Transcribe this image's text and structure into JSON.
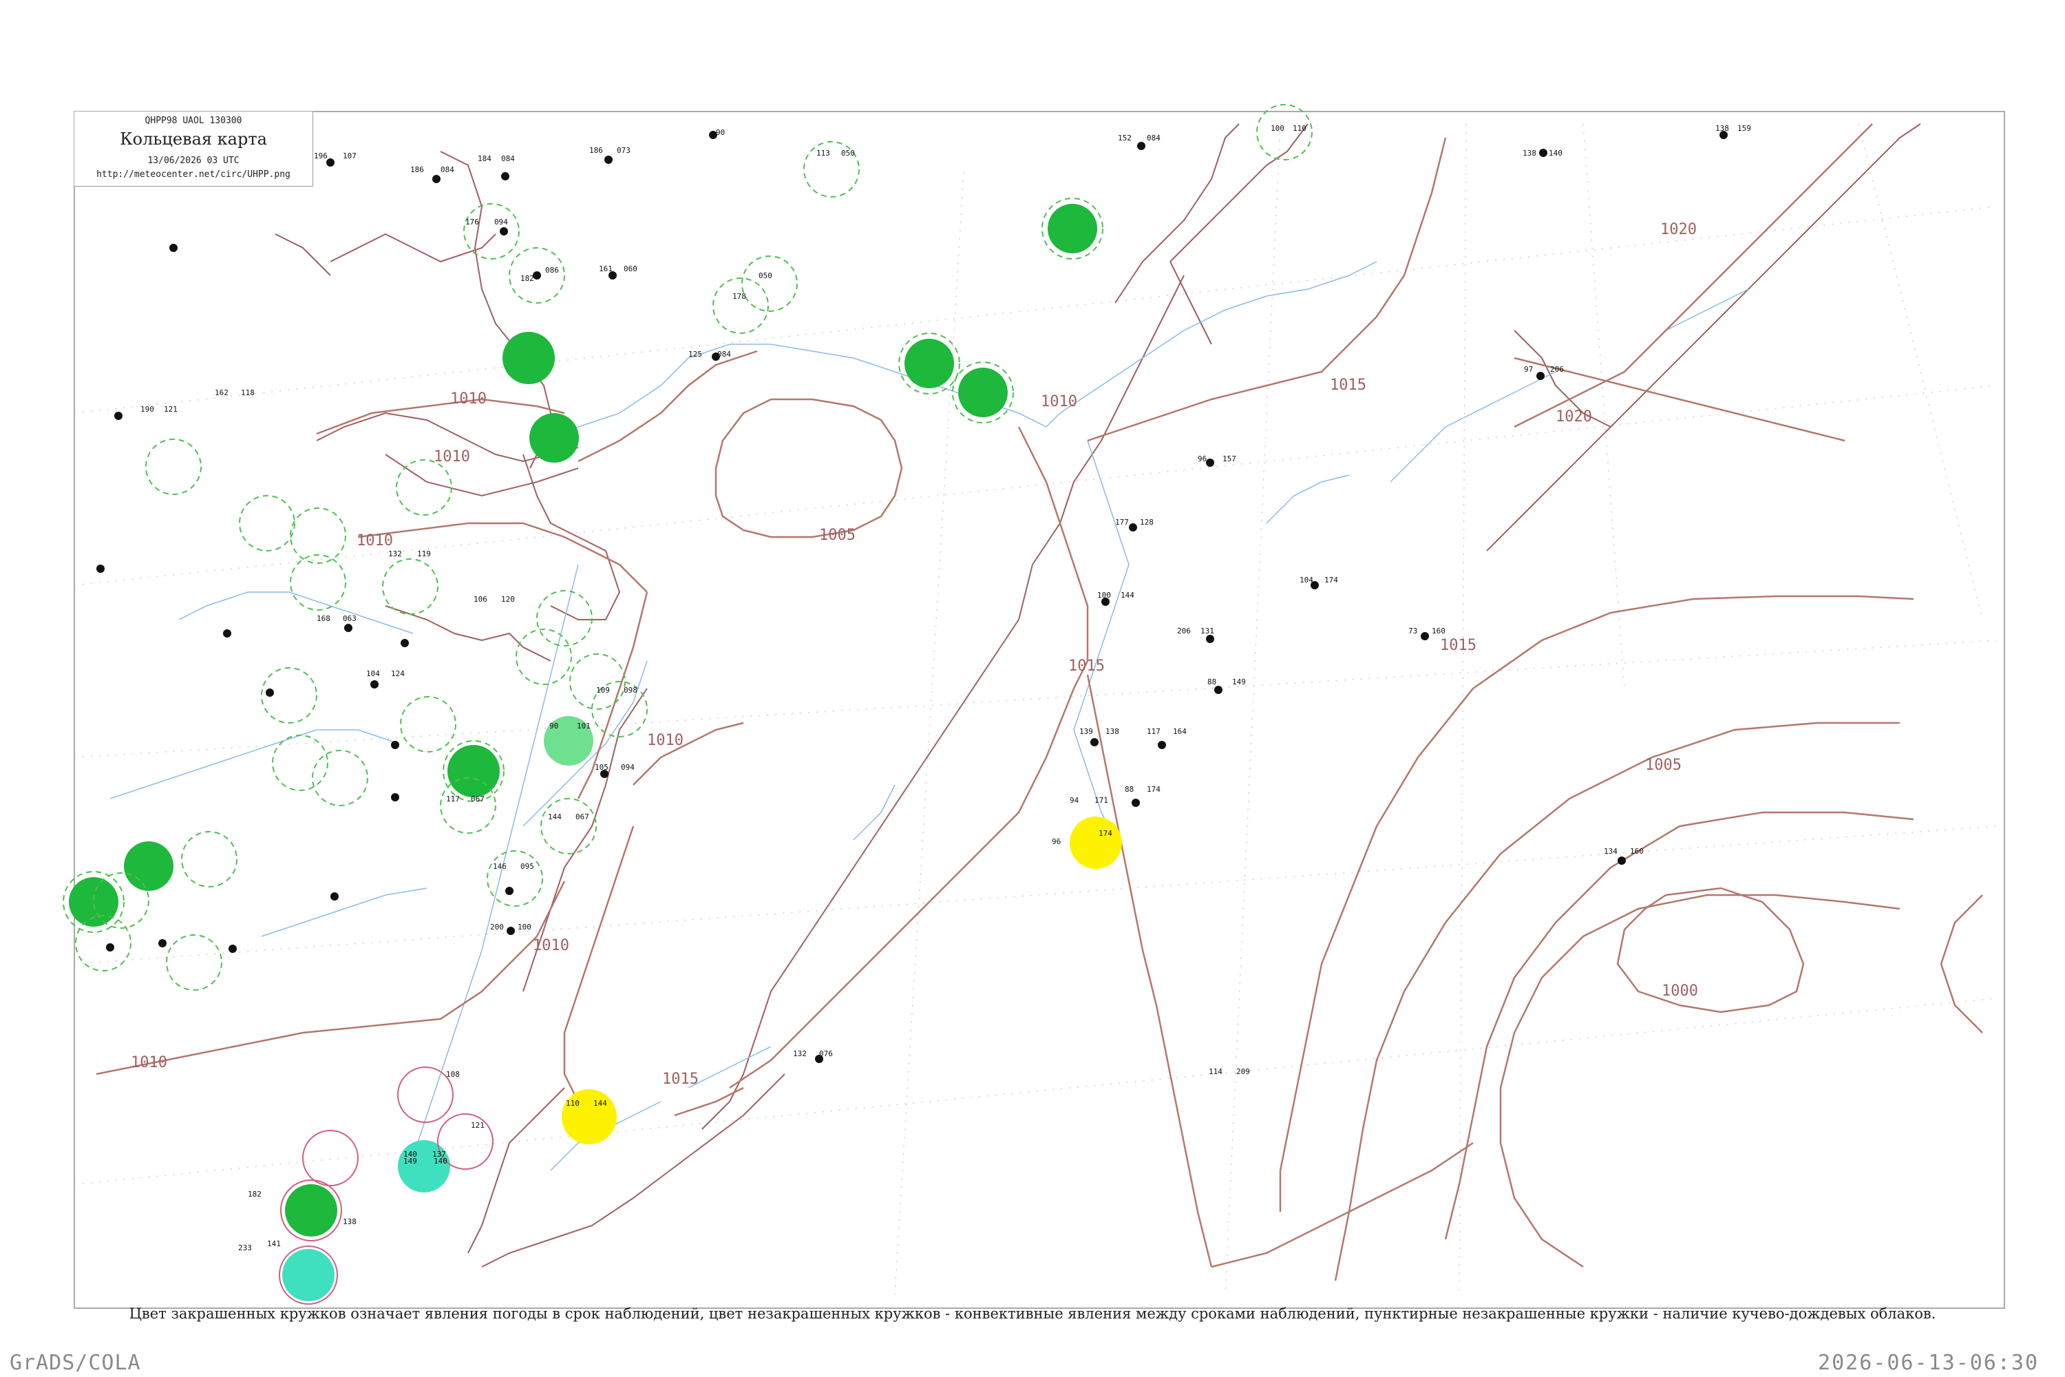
{
  "header": {
    "code": "QHPP98  UAOL  130300",
    "title": "Кольцевая карта",
    "time": "13/06/2026 03 UTC",
    "url": "http://meteocenter.net/circ/UHPP.png"
  },
  "legend": "Цвет закрашенных кружков означает явления погоды в срок наблюдений, цвет незакрашенных кружков - конвективные явления между сроками наблюдений, пунктирные незакрашенные кружки - наличие кучево-дождевых облаков.",
  "footer": {
    "software": "GrADS/COLA",
    "timestamp": "2026-06-13-06:30"
  },
  "isobars": [
    {
      "value": "1020",
      "label": "1020"
    },
    {
      "value": "1020",
      "label": "1020"
    },
    {
      "value": "1015",
      "label": "1015"
    },
    {
      "value": "1015",
      "label": "1015"
    },
    {
      "value": "1015",
      "label": "1015"
    },
    {
      "value": "1015",
      "label": "1015"
    },
    {
      "value": "1010",
      "label": "1010"
    },
    {
      "value": "1010",
      "label": "1010"
    },
    {
      "value": "1010",
      "label": "1010"
    },
    {
      "value": "1010",
      "label": "1010"
    },
    {
      "value": "1010",
      "label": "1010"
    },
    {
      "value": "1010",
      "label": "1010"
    },
    {
      "value": "1010",
      "label": "1010"
    },
    {
      "value": "1005",
      "label": "1005"
    },
    {
      "value": "1005",
      "label": "1005"
    },
    {
      "value": "1000",
      "label": "1000"
    }
  ],
  "stations": [
    {
      "id": "31004",
      "temp": "196",
      "press": "107"
    },
    {
      "id": "31088",
      "temp": "186",
      "press": "084"
    },
    {
      "id": "24966",
      "temp": "184",
      "press": "084"
    },
    {
      "id": "24959",
      "temp": "186",
      "press": "073"
    },
    {
      "id": "24668",
      "temp": "152",
      "press": "084"
    },
    {
      "id": "25700",
      "temp": "90",
      "press": ""
    },
    {
      "id": "25173",
      "temp": "113",
      "press": "050"
    },
    {
      "id": "25400",
      "temp": "100",
      "press": "110"
    },
    {
      "id": "25551",
      "temp": "138",
      "press": "140"
    },
    {
      "id": "25913",
      "temp": "138",
      "press": "159"
    },
    {
      "id": "31152",
      "temp": "178",
      "press": "050"
    },
    {
      "id": "31174",
      "temp": "182",
      "press": "086"
    },
    {
      "id": "31062",
      "temp": "161",
      "press": "060"
    },
    {
      "id": "31387",
      "temp": "125",
      "press": "084"
    },
    {
      "id": "31168",
      "temp": "162",
      "press": "118"
    },
    {
      "id": "31053",
      "temp": "176",
      "press": "094"
    },
    {
      "id": "31416",
      "temp": "190",
      "press": "121"
    },
    {
      "id": "32287",
      "temp": "177",
      "press": "128"
    },
    {
      "id": "32252",
      "temp": "96",
      "press": "157"
    },
    {
      "id": "32408",
      "temp": "104",
      "press": "174"
    },
    {
      "id": "32411",
      "temp": "100",
      "press": "144"
    },
    {
      "id": "32510",
      "temp": "73",
      "press": "160"
    },
    {
      "id": "32447",
      "temp": "206",
      "press": "131"
    },
    {
      "id": "32389",
      "temp": "88",
      "press": "149"
    },
    {
      "id": "32564",
      "temp": "117",
      "press": "164"
    },
    {
      "id": "32540",
      "temp": "139",
      "press": "138"
    },
    {
      "id": "32594",
      "temp": "88",
      "press": "174"
    },
    {
      "id": "32618",
      "temp": "94",
      "press": "171"
    },
    {
      "id": "32215",
      "temp": "96",
      "press": "174"
    },
    {
      "id": "31770",
      "temp": "134",
      "press": "160"
    },
    {
      "id": "32217",
      "temp": "97",
      "press": "206"
    },
    {
      "id": "31960",
      "temp": "200",
      "press": "100"
    },
    {
      "id": "31873",
      "temp": "146",
      "press": "095"
    },
    {
      "id": "31913",
      "temp": "144",
      "press": "067"
    },
    {
      "id": "32061",
      "temp": "105",
      "press": "094"
    },
    {
      "id": "32031",
      "temp": "90",
      "press": "101"
    },
    {
      "id": "32100",
      "temp": "109",
      "press": "098"
    },
    {
      "id": "31735",
      "temp": "117",
      "press": "067"
    },
    {
      "id": "31532",
      "temp": "132",
      "press": "119"
    },
    {
      "id": "31702",
      "temp": "106",
      "press": "120"
    },
    {
      "id": "31445",
      "temp": "168",
      "press": "063"
    },
    {
      "id": "31329",
      "temp": "104",
      "press": "124"
    },
    {
      "id": "47059",
      "temp": "132",
      "press": "076"
    },
    {
      "id": "47110",
      "temp": "110",
      "press": "144"
    },
    {
      "id": "47412",
      "temp": "108",
      "press": "121"
    },
    {
      "id": "47418",
      "temp": "140",
      "press": "137"
    },
    {
      "id": "47420",
      "temp": "149",
      "press": "140"
    },
    {
      "id": "47439",
      "temp": "233",
      "press": "141"
    },
    {
      "id": "47447",
      "temp": "182",
      "press": "138"
    },
    {
      "id": "47058",
      "temp": "114",
      "press": "209"
    }
  ]
}
